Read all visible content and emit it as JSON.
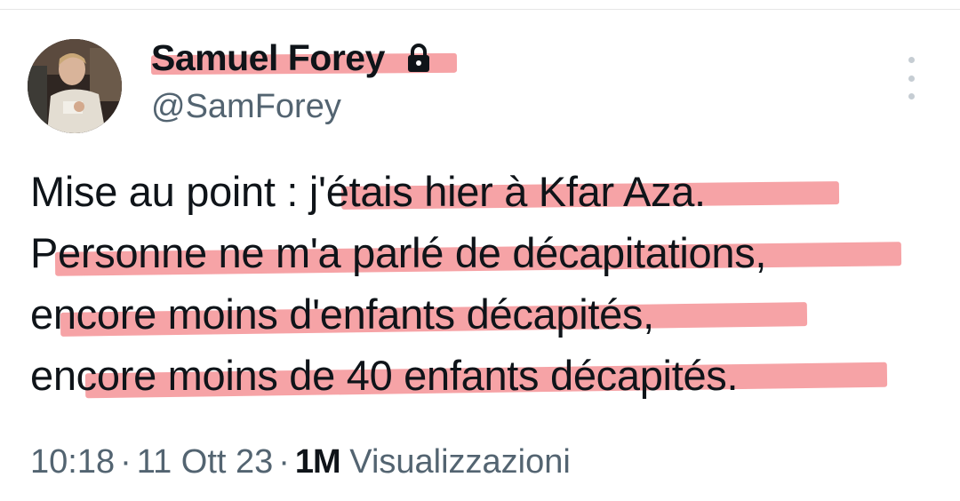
{
  "author": {
    "name": "Samuel Forey",
    "handle": "@SamForey",
    "protected_icon": "lock-icon",
    "avatar_icon": "profile-photo"
  },
  "tweet": {
    "lines": [
      "Mise au point : j'étais hier à Kfar Aza.",
      "Personne ne m'a parlé de décapitations,",
      "encore moins d'enfants décapités,",
      "encore moins de 40 enfants décapités."
    ],
    "highlight_color": "#f59ea1"
  },
  "meta": {
    "time": "10:18",
    "separator": "·",
    "date": "11 Ott 23",
    "views_count": "1M",
    "views_label": "Visualizzazioni"
  },
  "more_icon": "more-vertical-icon"
}
